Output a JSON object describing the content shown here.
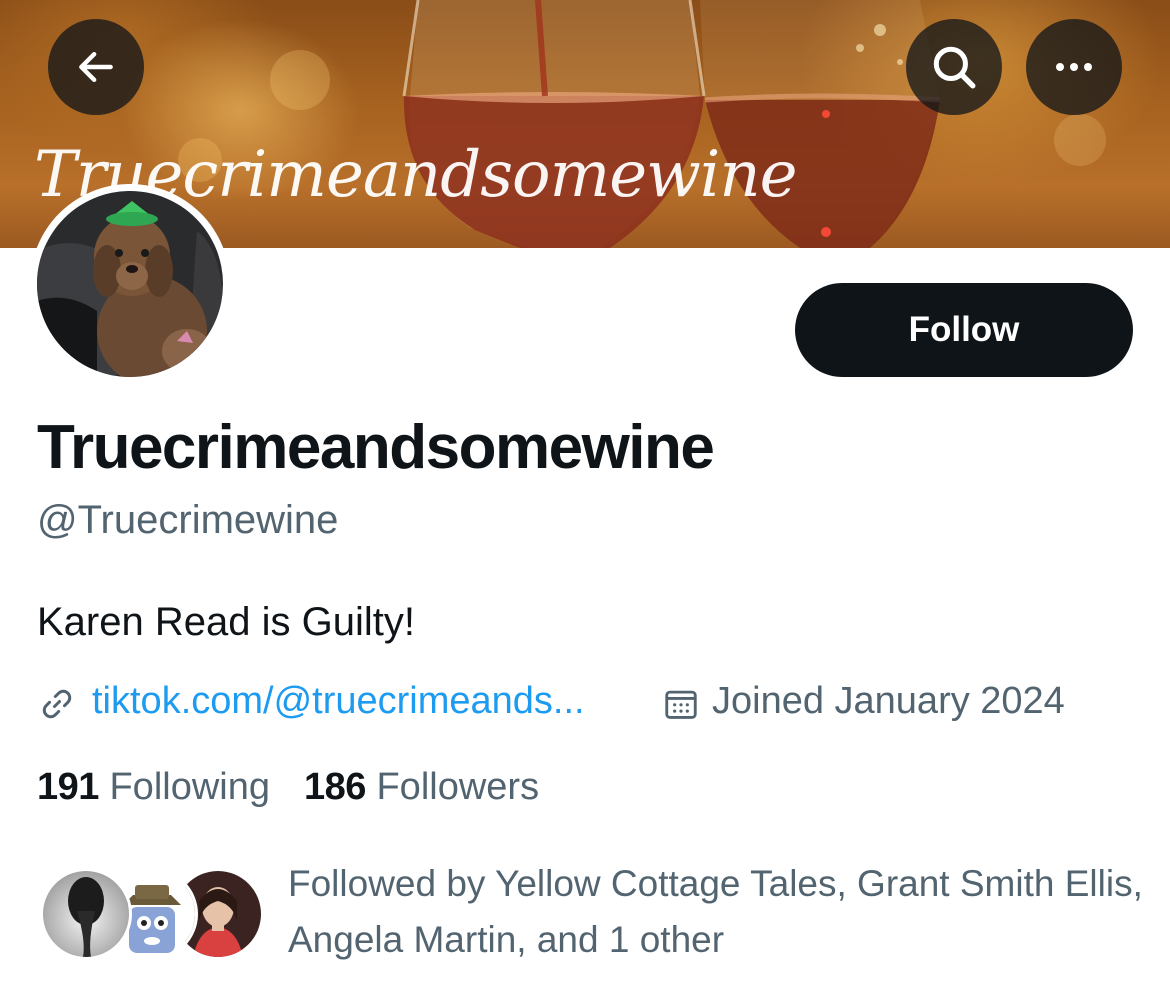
{
  "header": {
    "banner_title": "Truecrimeandsomewine",
    "back_icon": "arrow-left-icon",
    "search_icon": "search-icon",
    "more_icon": "more-horizontal-icon"
  },
  "profile": {
    "display_name": "Truecrimeandsomewine",
    "handle": "@Truecrimewine",
    "bio": "Karen Read is Guilty!",
    "website": "tiktok.com/@truecrimeands...",
    "joined": "Joined January 2024",
    "follow_label": "Follow"
  },
  "stats": {
    "following_count": "191",
    "following_label": "Following",
    "followers_count": "186",
    "followers_label": "Followers"
  },
  "followed_by": {
    "text": "Followed by Yellow Cottage Tales, Grant Smith Ellis, Angela Martin, and 1 other"
  },
  "colors": {
    "accent": "#1d9bf0",
    "text_primary": "#0f1419",
    "text_secondary": "#536471",
    "follow_button_bg": "#0f1419"
  }
}
